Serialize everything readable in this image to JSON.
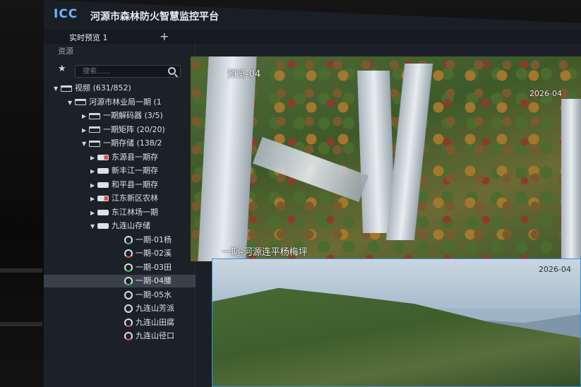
{
  "header": {
    "logo": "ICC",
    "title": "河源市森林防火智慧监控平台"
  },
  "tabs": [
    {
      "label": "实时预览 1"
    }
  ],
  "tab_add": "+",
  "sidebar": {
    "header": "资源",
    "search_placeholder": "搜索......",
    "tree": [
      {
        "label": "视频 (631/852)",
        "level": 0,
        "type": "folder",
        "expanded": true
      },
      {
        "label": "河源市林业局一期 (1",
        "level": 1,
        "type": "folder",
        "expanded": true
      },
      {
        "label": "一期解码器 (3/5)",
        "level": 2,
        "type": "folder",
        "expanded": false
      },
      {
        "label": "一期矩阵 (20/20)",
        "level": 2,
        "type": "folder",
        "expanded": false
      },
      {
        "label": "一期存储 (138/2",
        "level": 2,
        "type": "folder",
        "expanded": true
      },
      {
        "label": "东源县一期存",
        "level": 3,
        "type": "device",
        "status": "red"
      },
      {
        "label": "新丰江一期存",
        "level": 3,
        "type": "device",
        "status": "normal"
      },
      {
        "label": "和平县一期存",
        "level": 3,
        "type": "device",
        "status": "normal"
      },
      {
        "label": "江东新区农林",
        "level": 3,
        "type": "device",
        "status": "red"
      },
      {
        "label": "东江林场一期",
        "level": 3,
        "type": "device",
        "status": "normal"
      },
      {
        "label": "九连山存储",
        "level": 3,
        "type": "device",
        "status": "normal",
        "expanded": true
      },
      {
        "label": "一期-01杨",
        "level": 4,
        "type": "camera",
        "status": "green"
      },
      {
        "label": "一期-02溪",
        "level": 4,
        "type": "camera",
        "status": "red"
      },
      {
        "label": "一期-03田",
        "level": 4,
        "type": "camera",
        "status": "green"
      },
      {
        "label": "一期-04腰",
        "level": 4,
        "type": "camera",
        "status": "green",
        "selected": true
      },
      {
        "label": "一期-05水",
        "level": 4,
        "type": "camera",
        "status": "normal"
      },
      {
        "label": "九连山芳派",
        "level": 4,
        "type": "camera",
        "status": "normal"
      },
      {
        "label": "九连山田腐",
        "level": 4,
        "type": "camera",
        "status": "red"
      },
      {
        "label": "九连山径口",
        "level": 4,
        "type": "camera",
        "status": "red"
      }
    ]
  },
  "tiles": [
    {
      "top_label": "预览-04",
      "ts": "2026-04",
      "bottom_label": "一期-河源连平杨梅坪"
    },
    {
      "ts": "2026-04"
    }
  ]
}
